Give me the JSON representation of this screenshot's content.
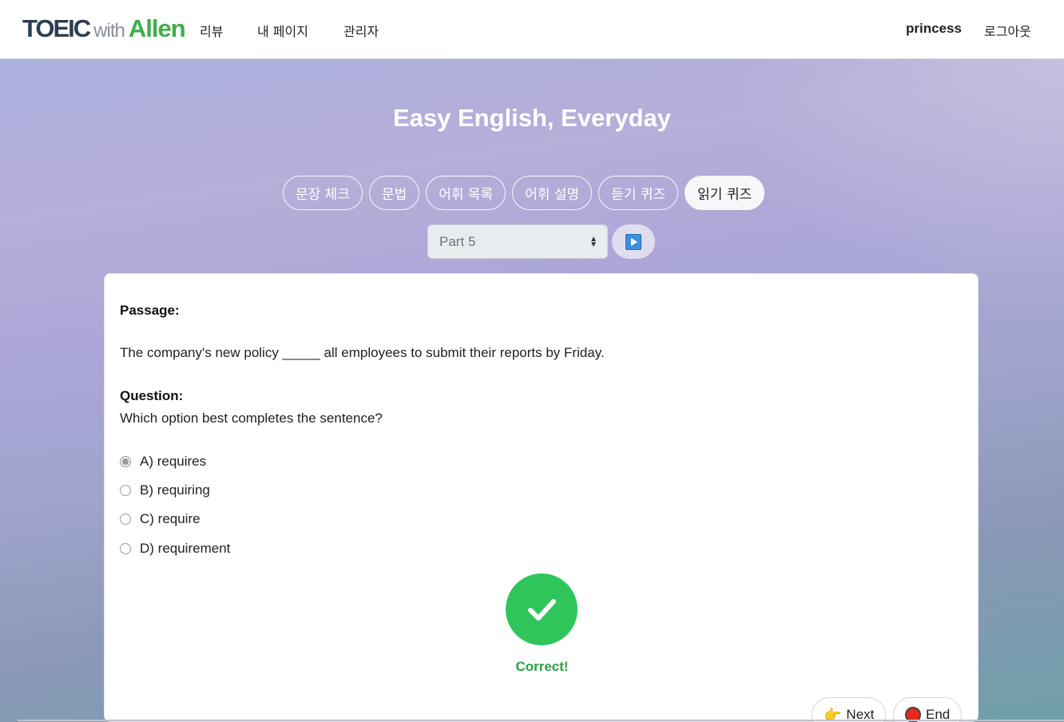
{
  "header": {
    "logo": {
      "part1": "TOEIC",
      "part2": "with",
      "part3": "Allen"
    },
    "nav": [
      "리뷰",
      "내 페이지",
      "관리자"
    ],
    "username": "princess",
    "logout_label": "로그아웃"
  },
  "hero": {
    "headline": "Easy English, Everyday",
    "tabs": [
      {
        "label": "문장 체크",
        "active": false
      },
      {
        "label": "문법",
        "active": false
      },
      {
        "label": "어휘 목록",
        "active": false
      },
      {
        "label": "어휘 설명",
        "active": false
      },
      {
        "label": "듣기 퀴즈",
        "active": false
      },
      {
        "label": "읽기 퀴즈",
        "active": true
      }
    ],
    "part_select": {
      "selected": "Part 5"
    },
    "play_icon": "play-icon"
  },
  "quiz": {
    "passage_label": "Passage:",
    "passage_text": "The company's new policy _____ all employees to submit their reports by Friday.",
    "question_label": "Question:",
    "question_text": "Which option best completes the sentence?",
    "options": [
      {
        "label": "A) requires",
        "checked": true
      },
      {
        "label": "B) requiring",
        "checked": false
      },
      {
        "label": "C) require",
        "checked": false
      },
      {
        "label": "D) requirement",
        "checked": false
      }
    ],
    "result_text": "Correct!",
    "result_color": "#2fc55a",
    "next_label": "Next",
    "end_label": "End"
  },
  "colors": {
    "brand_dark": "#2d3e50",
    "brand_green": "#3fae49",
    "success_text": "#27a343"
  }
}
